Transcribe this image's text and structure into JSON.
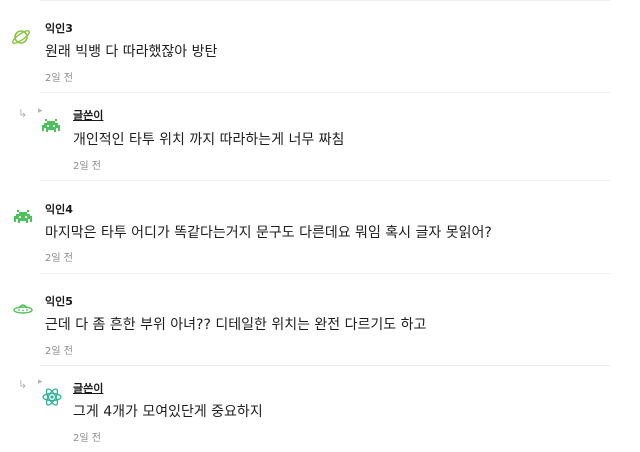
{
  "comments": [
    {
      "author": "익인3",
      "text": "원래 빅뱅 다 따라했잖아 방탄",
      "time": "2일 전",
      "avatar_icon": "planet-icon",
      "is_reply": false
    },
    {
      "author": "글쓴이",
      "text": "개인적인 타투 위치 까지 따라하는게 너무 짜침",
      "time": "2일 전",
      "avatar_icon": "space-invader-icon",
      "is_reply": true
    },
    {
      "author": "익인4",
      "text": "마지막은 타투 어디가 똑같다는거지 문구도 다른데요 뭐임 혹시 글자 못읽어?",
      "time": "2일 전",
      "avatar_icon": "space-invader-icon",
      "is_reply": false
    },
    {
      "author": "익인5",
      "text": "근데 다 좀 흔한 부위 아녀?? 디테일한 위치는 완전 다르기도 하고",
      "time": "2일 전",
      "avatar_icon": "ufo-icon",
      "is_reply": false
    },
    {
      "author": "글쓴이",
      "text": "그게 4개가 모여있단게 중요하지",
      "time": "2일 전",
      "avatar_icon": "atom-icon",
      "is_reply": true
    }
  ],
  "colors": {
    "icon_green": "#4cc25a",
    "icon_teal": "#2bb39a",
    "muted_text": "#8a8a8a"
  }
}
